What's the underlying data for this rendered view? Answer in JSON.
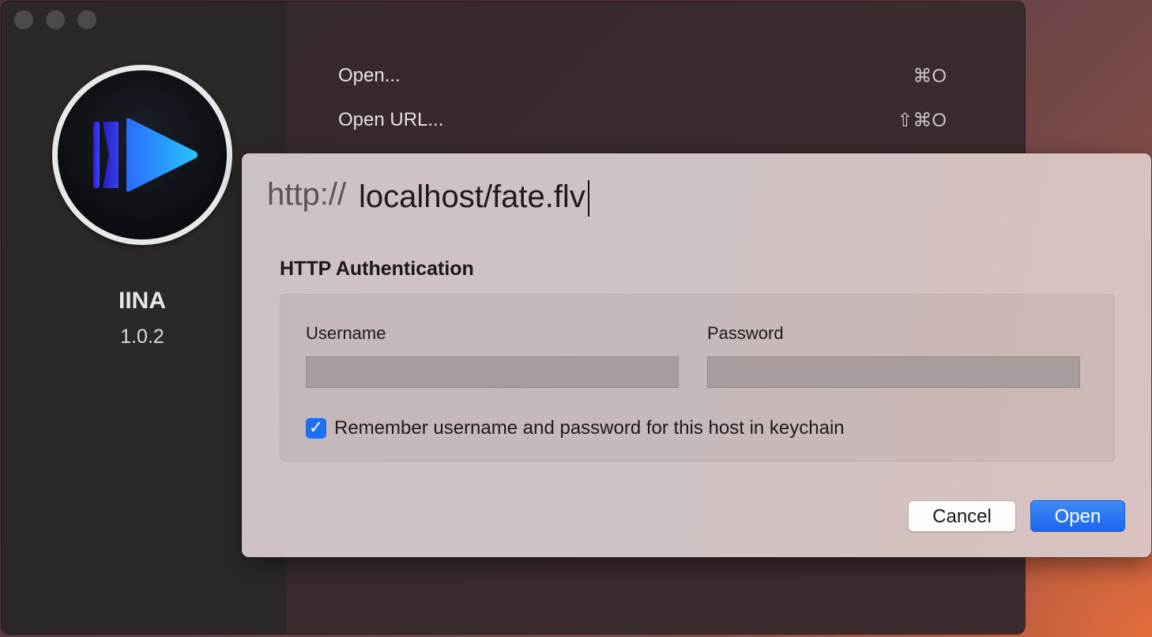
{
  "app": {
    "name": "IINA",
    "version": "1.0.2"
  },
  "menu": {
    "items": [
      {
        "label": "Open...",
        "shortcut": "⌘O"
      },
      {
        "label": "Open URL...",
        "shortcut": "⇧⌘O"
      }
    ]
  },
  "dialog": {
    "url_prefix": "http://",
    "url_value": "localhost/fate.flv",
    "auth_title": "HTTP Authentication",
    "username_label": "Username",
    "username_value": "",
    "password_label": "Password",
    "password_value": "",
    "remember_checked": true,
    "remember_label": "Remember username and password for this host in keychain",
    "cancel_label": "Cancel",
    "open_label": "Open"
  },
  "colors": {
    "accent": "#1f6ff2",
    "sidebar": "#2c2828",
    "dialog_bg": "#cfc3c3"
  }
}
